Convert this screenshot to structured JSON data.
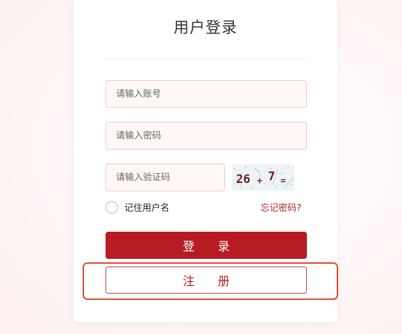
{
  "login": {
    "title": "用户登录",
    "account_placeholder": "请输入账号",
    "password_placeholder": "请输入密码",
    "captcha_placeholder": "请输入验证码",
    "captcha_text": [
      "26",
      "+",
      "7",
      "="
    ],
    "remember_label": "记住用户名",
    "forgot_label": "忘记密码?",
    "login_button": "登 录",
    "register_button": "注 册"
  },
  "colors": {
    "primary": "#b71c24",
    "input_border": "#f0c9c9",
    "input_bg": "#fff8f7",
    "highlight": "#d9472a"
  }
}
